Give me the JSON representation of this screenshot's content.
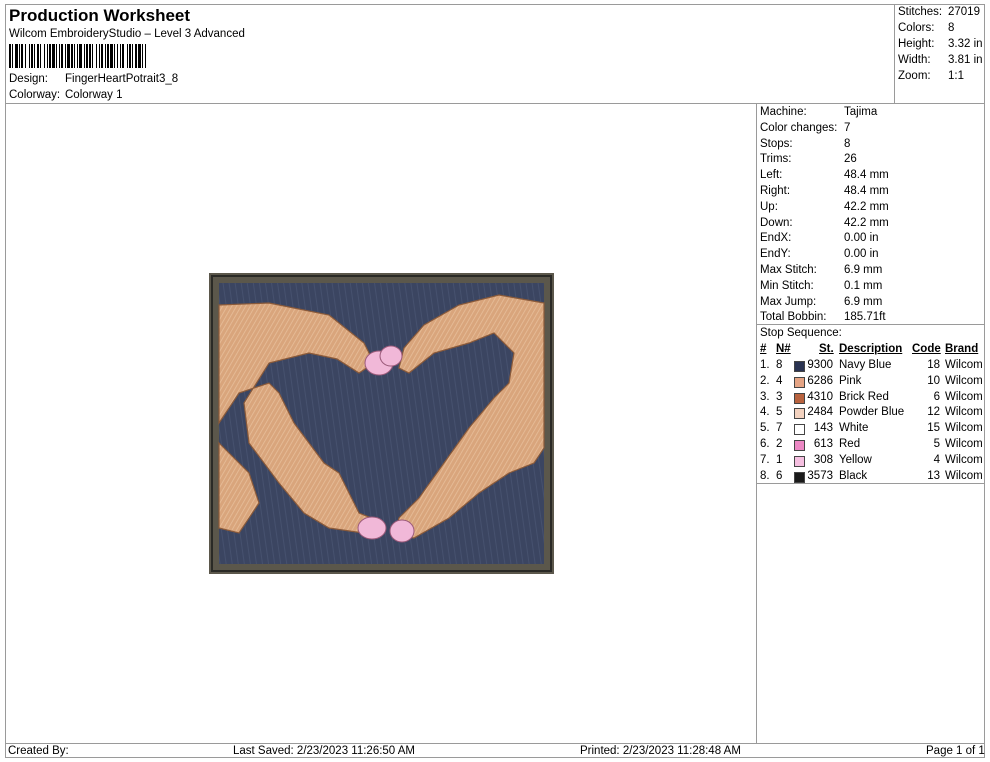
{
  "header": {
    "title": "Production Worksheet",
    "software": "Wilcom EmbroideryStudio – Level 3 Advanced",
    "design_label": "Design:",
    "design_value": "FingerHeartPotrait3_8",
    "colorway_label": "Colorway:",
    "colorway_value": "Colorway 1"
  },
  "summary": [
    {
      "label": "Stitches:",
      "value": "27019"
    },
    {
      "label": "Colors:",
      "value": "8"
    },
    {
      "label": "Height:",
      "value": "3.32 in"
    },
    {
      "label": "Width:",
      "value": "3.81 in"
    },
    {
      "label": "Zoom:",
      "value": "1:1"
    }
  ],
  "details": [
    {
      "label": "Machine:",
      "value": "Tajima"
    },
    {
      "label": "Color changes:",
      "value": "7"
    },
    {
      "label": "Stops:",
      "value": "8"
    },
    {
      "label": "Trims:",
      "value": "26"
    },
    {
      "label": "Left:",
      "value": "48.4 mm"
    },
    {
      "label": "Right:",
      "value": "48.4 mm"
    },
    {
      "label": "Up:",
      "value": "42.2 mm"
    },
    {
      "label": "Down:",
      "value": "42.2 mm"
    },
    {
      "label": "EndX:",
      "value": "0.00 in"
    },
    {
      "label": "EndY:",
      "value": "0.00 in"
    },
    {
      "label": "Max Stitch:",
      "value": "6.9 mm"
    },
    {
      "label": "Min Stitch:",
      "value": "0.1 mm"
    },
    {
      "label": "Max Jump:",
      "value": "6.9 mm"
    },
    {
      "label": "Total Bobbin:",
      "value": "185.71ft"
    }
  ],
  "stop_sequence": {
    "title": "Stop Sequence:",
    "headers": {
      "num": "#",
      "n": "N#",
      "st": "St.",
      "desc": "Description",
      "code": "Code",
      "brand": "Brand"
    },
    "rows": [
      {
        "num": "1.",
        "n": "8",
        "color": "#2a3352",
        "st": "9300",
        "desc": "Navy Blue",
        "code": "18",
        "brand": "Wilcom"
      },
      {
        "num": "2.",
        "n": "4",
        "color": "#e5a484",
        "st": "6286",
        "desc": "Pink",
        "code": "10",
        "brand": "Wilcom"
      },
      {
        "num": "3.",
        "n": "3",
        "color": "#b8623e",
        "st": "4310",
        "desc": "Brick Red",
        "code": "6",
        "brand": "Wilcom"
      },
      {
        "num": "4.",
        "n": "5",
        "color": "#f3d2bf",
        "st": "2484",
        "desc": "Powder Blue",
        "code": "12",
        "brand": "Wilcom"
      },
      {
        "num": "5.",
        "n": "7",
        "color": "#ffffff",
        "st": "143",
        "desc": "White",
        "code": "15",
        "brand": "Wilcom"
      },
      {
        "num": "6.",
        "n": "2",
        "color": "#ec88c4",
        "st": "613",
        "desc": "Red",
        "code": "5",
        "brand": "Wilcom"
      },
      {
        "num": "7.",
        "n": "1",
        "color": "#f5bfe0",
        "st": "308",
        "desc": "Yellow",
        "code": "4",
        "brand": "Wilcom"
      },
      {
        "num": "8.",
        "n": "6",
        "color": "#1a1a1a",
        "st": "3573",
        "desc": "Black",
        "code": "13",
        "brand": "Wilcom"
      }
    ]
  },
  "footer": {
    "created": "Created By:",
    "last_saved": "Last Saved: 2/23/2023 11:26:50 AM",
    "printed": "Printed: 2/23/2023 11:28:48 AM",
    "page": "Page 1 of 1"
  }
}
